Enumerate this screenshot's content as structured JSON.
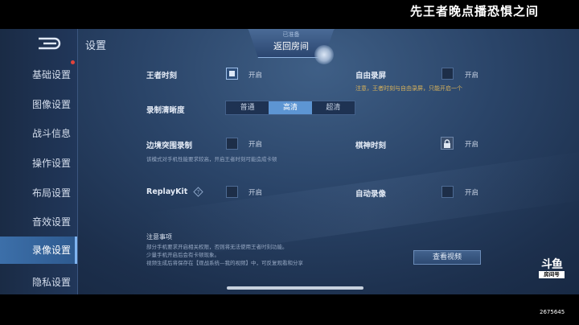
{
  "stream_title": "先王者晚点播恐惧之间",
  "header": {
    "title": "设置",
    "return_small": "已准备",
    "return_label": "返回房间"
  },
  "sidebar": {
    "items": [
      {
        "label": "基础设置",
        "active": false
      },
      {
        "label": "图像设置",
        "active": false
      },
      {
        "label": "战斗信息",
        "active": false
      },
      {
        "label": "操作设置",
        "active": false
      },
      {
        "label": "布局设置",
        "active": false
      },
      {
        "label": "音效设置",
        "active": false
      },
      {
        "label": "录像设置",
        "active": true
      },
      {
        "label": "隐私设置",
        "active": false
      }
    ]
  },
  "settings": {
    "king_moment": {
      "label": "王者时刻",
      "toggle": "开启",
      "checked": true
    },
    "free_record": {
      "label": "自由录屏",
      "toggle": "开启",
      "checked": false,
      "warning": "注意，王者时刻与自由录屏，只能开启一个"
    },
    "quality": {
      "label": "录制清晰度",
      "options": [
        "普通",
        "高清",
        "超清"
      ],
      "selected": "高清"
    },
    "border_record": {
      "label": "边境突围录制",
      "toggle": "开启",
      "checked": false,
      "note": "该模式对手机性能要求较高，开启王者时刻可能造成卡顿"
    },
    "chess_moment": {
      "label": "棋神时刻",
      "toggle": "开启",
      "locked": true
    },
    "replaykit": {
      "label": "ReplayKit",
      "toggle": "开启",
      "checked": false
    },
    "auto_record": {
      "label": "自动录像",
      "toggle": "开启",
      "checked": false
    }
  },
  "notice": {
    "title": "注意事项",
    "line1": "部分手机要求开启相关权限，否则将无法使用王者时刻功能。",
    "line2": "少量手机开启后会有卡顿现象。",
    "line3": "视频生成后将保存在【观战系统—我的视频】中，可反复观看和分享",
    "view_button": "查看视频"
  },
  "watermark": {
    "logo": "斗鱼",
    "sub": "房间号",
    "room_id": "2675645"
  },
  "colors": {
    "accent": "#5d95d3",
    "warning": "#d9b25a",
    "background": "#223a5c"
  }
}
